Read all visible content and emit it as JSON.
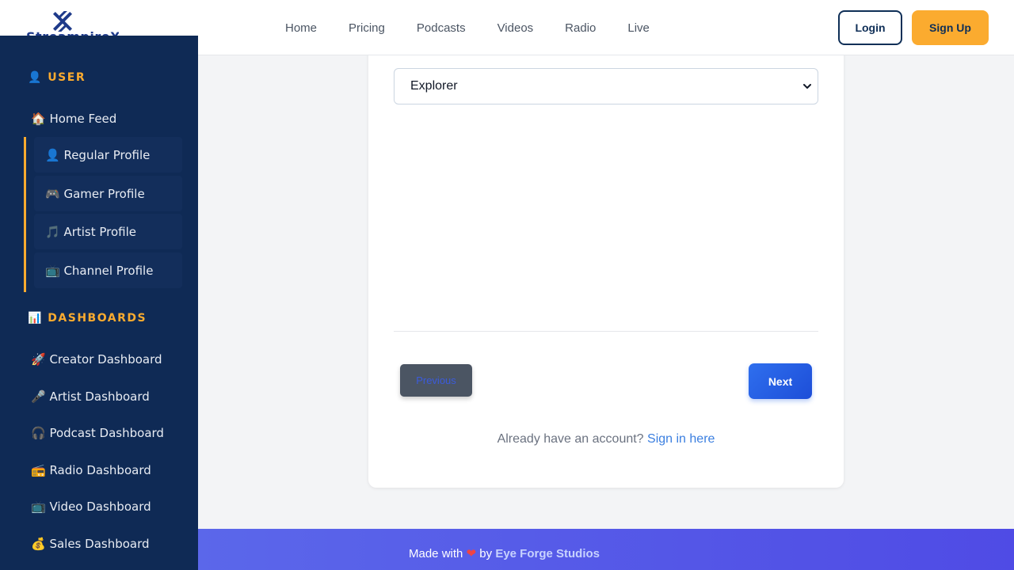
{
  "brand": {
    "name": "StreampireX",
    "accent_color": "#fbab2f",
    "primary_color": "#0f2a55"
  },
  "nav": {
    "links": [
      "Home",
      "Pricing",
      "Podcasts",
      "Videos",
      "Radio",
      "Live"
    ],
    "login_label": "Login",
    "signup_label": "Sign Up"
  },
  "sidebar": {
    "user_section": "👤 USER",
    "home_feed": "🏠 Home Feed",
    "profiles": [
      "👤 Regular Profile",
      "🎮 Gamer Profile",
      "🎵 Artist Profile",
      "📺 Channel Profile"
    ],
    "dashboards_section": "📊 DASHBOARDS",
    "dashboards": [
      "🚀 Creator Dashboard",
      "🎤 Artist Dashboard",
      "🎧 Podcast Dashboard",
      "📻 Radio Dashboard",
      "📺 Video Dashboard",
      "💰 Sales Dashboard"
    ]
  },
  "form": {
    "select_value": "Explorer",
    "prev_label": "Previous",
    "next_label": "Next",
    "have_account_text": "Already have an account?",
    "signin_link": "Sign in here"
  },
  "footer": {
    "made_with": "Made with",
    "heart": "❤",
    "by": "by",
    "studio": "Eye Forge Studios"
  }
}
